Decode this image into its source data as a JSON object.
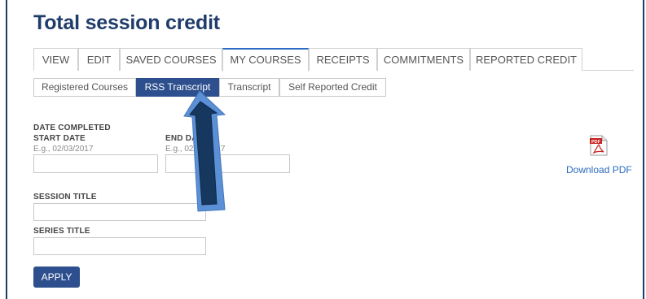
{
  "page": {
    "title": "Total session credit"
  },
  "tabs": [
    {
      "label": "VIEW"
    },
    {
      "label": "EDIT"
    },
    {
      "label": "SAVED COURSES"
    },
    {
      "label": "MY COURSES",
      "active": true
    },
    {
      "label": "RECEIPTS"
    },
    {
      "label": "COMMITMENTS"
    },
    {
      "label": "REPORTED CREDIT"
    }
  ],
  "subtabs": [
    {
      "label": "Registered Courses"
    },
    {
      "label": "RSS Transcript",
      "active": true
    },
    {
      "label": "Transcript"
    },
    {
      "label": "Self Reported Credit"
    }
  ],
  "form": {
    "date_completed_label": "DATE COMPLETED",
    "start_date_label": "START DATE",
    "start_date_placeholder": "E.g., 02/03/2017",
    "end_date_label": "END DATE",
    "end_date_placeholder": "E.g., 02/03/2017",
    "session_title_label": "SESSION TITLE",
    "series_title_label": "SERIES TITLE",
    "apply_label": "APPLY"
  },
  "download": {
    "label": "Download PDF",
    "icon": "pdf-icon",
    "badge": "PDF"
  },
  "annotation": {
    "icon": "pointer-arrow-icon",
    "color": "#5b8fd6"
  }
}
